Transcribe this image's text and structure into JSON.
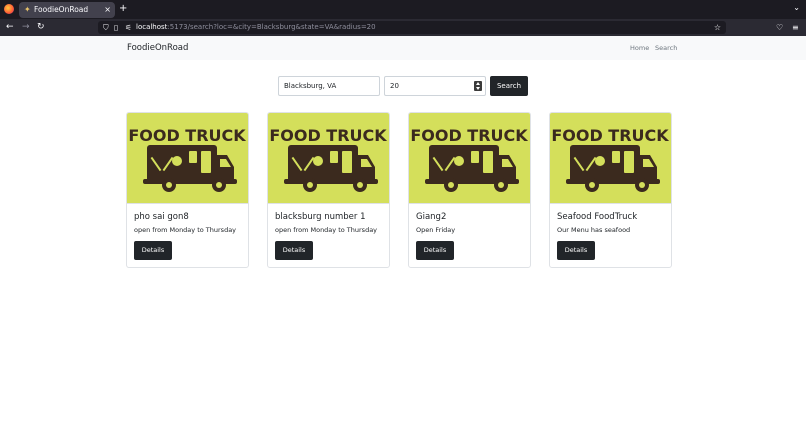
{
  "browser": {
    "tab_title": "FoodieOnRoad",
    "tab_close": "×",
    "new_tab": "+",
    "url_host": "localhost",
    "url_rest": ":5173/search?loc=&city=Blacksburg&state=VA&radius=20"
  },
  "header": {
    "brand": "FoodieOnRoad",
    "nav": [
      {
        "label": "Home"
      },
      {
        "label": "Search"
      }
    ]
  },
  "search": {
    "location_value": "Blacksburg, VA",
    "radius_value": "20",
    "button_label": "Search"
  },
  "image_text": {
    "line1": "FOOD TRUCK"
  },
  "colors": {
    "image_bg": "#d4df5b",
    "truck": "#3b2a1e",
    "button_bg": "#212529"
  },
  "cards": [
    {
      "title": "pho sai gon8",
      "text": "open from Monday to Thursday",
      "button": "Details"
    },
    {
      "title": "blacksburg number 1",
      "text": "open from Monday to Thursday",
      "button": "Details"
    },
    {
      "title": "Giang2",
      "text": "Open Friday",
      "button": "Details"
    },
    {
      "title": "Seafood FoodTruck",
      "text": "Our Menu has seafood",
      "button": "Details"
    }
  ]
}
